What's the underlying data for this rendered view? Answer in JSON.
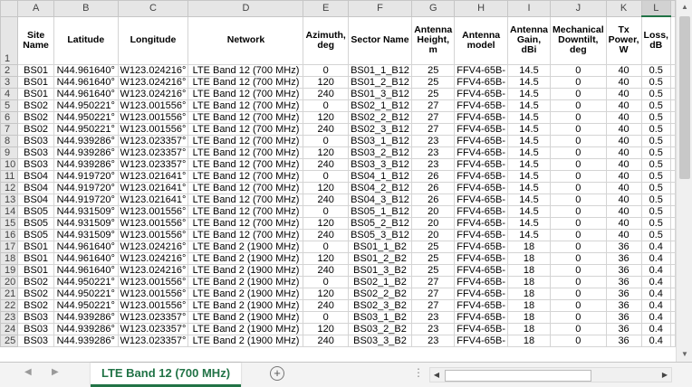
{
  "columns": [
    "A",
    "B",
    "C",
    "D",
    "E",
    "F",
    "G",
    "H",
    "I",
    "J",
    "K",
    "L"
  ],
  "selected_column": "L",
  "headers": [
    "Site Name",
    "Latitude",
    "Longitude",
    "Network",
    "Azimuth, deg",
    "Sector Name",
    "Antenna Height, m",
    "Antenna model",
    "Antenna Gain, dBi",
    "Mechanical Downtilt, deg",
    "Tx Power, W",
    "Loss, dB"
  ],
  "rows": [
    [
      "2",
      "BS01",
      "N44.961640°",
      "W123.024216°",
      "LTE Band 12 (700 MHz)",
      "0",
      "BS01_1_B12",
      "25",
      "FFV4-65B-",
      "14.5",
      "0",
      "40",
      "0.5"
    ],
    [
      "3",
      "BS01",
      "N44.961640°",
      "W123.024216°",
      "LTE Band 12 (700 MHz)",
      "120",
      "BS01_2_B12",
      "25",
      "FFV4-65B-",
      "14.5",
      "0",
      "40",
      "0.5"
    ],
    [
      "4",
      "BS01",
      "N44.961640°",
      "W123.024216°",
      "LTE Band 12 (700 MHz)",
      "240",
      "BS01_3_B12",
      "25",
      "FFV4-65B-",
      "14.5",
      "0",
      "40",
      "0.5"
    ],
    [
      "5",
      "BS02",
      "N44.950221°",
      "W123.001556°",
      "LTE Band 12 (700 MHz)",
      "0",
      "BS02_1_B12",
      "27",
      "FFV4-65B-",
      "14.5",
      "0",
      "40",
      "0.5"
    ],
    [
      "6",
      "BS02",
      "N44.950221°",
      "W123.001556°",
      "LTE Band 12 (700 MHz)",
      "120",
      "BS02_2_B12",
      "27",
      "FFV4-65B-",
      "14.5",
      "0",
      "40",
      "0.5"
    ],
    [
      "7",
      "BS02",
      "N44.950221°",
      "W123.001556°",
      "LTE Band 12 (700 MHz)",
      "240",
      "BS02_3_B12",
      "27",
      "FFV4-65B-",
      "14.5",
      "0",
      "40",
      "0.5"
    ],
    [
      "8",
      "BS03",
      "N44.939286°",
      "W123.023357°",
      "LTE Band 12 (700 MHz)",
      "0",
      "BS03_1_B12",
      "23",
      "FFV4-65B-",
      "14.5",
      "0",
      "40",
      "0.5"
    ],
    [
      "9",
      "BS03",
      "N44.939286°",
      "W123.023357°",
      "LTE Band 12 (700 MHz)",
      "120",
      "BS03_2_B12",
      "23",
      "FFV4-65B-",
      "14.5",
      "0",
      "40",
      "0.5"
    ],
    [
      "10",
      "BS03",
      "N44.939286°",
      "W123.023357°",
      "LTE Band 12 (700 MHz)",
      "240",
      "BS03_3_B12",
      "23",
      "FFV4-65B-",
      "14.5",
      "0",
      "40",
      "0.5"
    ],
    [
      "11",
      "BS04",
      "N44.919720°",
      "W123.021641°",
      "LTE Band 12 (700 MHz)",
      "0",
      "BS04_1_B12",
      "26",
      "FFV4-65B-",
      "14.5",
      "0",
      "40",
      "0.5"
    ],
    [
      "12",
      "BS04",
      "N44.919720°",
      "W123.021641°",
      "LTE Band 12 (700 MHz)",
      "120",
      "BS04_2_B12",
      "26",
      "FFV4-65B-",
      "14.5",
      "0",
      "40",
      "0.5"
    ],
    [
      "13",
      "BS04",
      "N44.919720°",
      "W123.021641°",
      "LTE Band 12 (700 MHz)",
      "240",
      "BS04_3_B12",
      "26",
      "FFV4-65B-",
      "14.5",
      "0",
      "40",
      "0.5"
    ],
    [
      "14",
      "BS05",
      "N44.931509°",
      "W123.001556°",
      "LTE Band 12 (700 MHz)",
      "0",
      "BS05_1_B12",
      "20",
      "FFV4-65B-",
      "14.5",
      "0",
      "40",
      "0.5"
    ],
    [
      "15",
      "BS05",
      "N44.931509°",
      "W123.001556°",
      "LTE Band 12 (700 MHz)",
      "120",
      "BS05_2_B12",
      "20",
      "FFV4-65B-",
      "14.5",
      "0",
      "40",
      "0.5"
    ],
    [
      "16",
      "BS05",
      "N44.931509°",
      "W123.001556°",
      "LTE Band 12 (700 MHz)",
      "240",
      "BS05_3_B12",
      "20",
      "FFV4-65B-",
      "14.5",
      "0",
      "40",
      "0.5"
    ],
    [
      "17",
      "BS01",
      "N44.961640°",
      "W123.024216°",
      "LTE Band 2 (1900 MHz)",
      "0",
      "BS01_1_B2",
      "25",
      "FFV4-65B-",
      "18",
      "0",
      "36",
      "0.4"
    ],
    [
      "18",
      "BS01",
      "N44.961640°",
      "W123.024216°",
      "LTE Band 2 (1900 MHz)",
      "120",
      "BS01_2_B2",
      "25",
      "FFV4-65B-",
      "18",
      "0",
      "36",
      "0.4"
    ],
    [
      "19",
      "BS01",
      "N44.961640°",
      "W123.024216°",
      "LTE Band 2 (1900 MHz)",
      "240",
      "BS01_3_B2",
      "25",
      "FFV4-65B-",
      "18",
      "0",
      "36",
      "0.4"
    ],
    [
      "20",
      "BS02",
      "N44.950221°",
      "W123.001556°",
      "LTE Band 2 (1900 MHz)",
      "0",
      "BS02_1_B2",
      "27",
      "FFV4-65B-",
      "18",
      "0",
      "36",
      "0.4"
    ],
    [
      "21",
      "BS02",
      "N44.950221°",
      "W123.001556°",
      "LTE Band 2 (1900 MHz)",
      "120",
      "BS02_2_B2",
      "27",
      "FFV4-65B-",
      "18",
      "0",
      "36",
      "0.4"
    ],
    [
      "22",
      "BS02",
      "N44.950221°",
      "W123.001556°",
      "LTE Band 2 (1900 MHz)",
      "240",
      "BS02_3_B2",
      "27",
      "FFV4-65B-",
      "18",
      "0",
      "36",
      "0.4"
    ],
    [
      "23",
      "BS03",
      "N44.939286°",
      "W123.023357°",
      "LTE Band 2 (1900 MHz)",
      "0",
      "BS03_1_B2",
      "23",
      "FFV4-65B-",
      "18",
      "0",
      "36",
      "0.4"
    ],
    [
      "24",
      "BS03",
      "N44.939286°",
      "W123.023357°",
      "LTE Band 2 (1900 MHz)",
      "120",
      "BS03_2_B2",
      "23",
      "FFV4-65B-",
      "18",
      "0",
      "36",
      "0.4"
    ],
    [
      "25",
      "BS03",
      "N44.939286°",
      "W123.023357°",
      "LTE Band 2 (1900 MHz)",
      "240",
      "BS03_3_B2",
      "23",
      "FFV4-65B-",
      "18",
      "0",
      "36",
      "0.4"
    ]
  ],
  "sheet_tab": "LTE Band 12 (700 MHz)",
  "colors": {
    "accent": "#217346",
    "header_bg": "#e6e6e6"
  },
  "icons": {
    "add_sheet": "plus-circle-icon",
    "nav_left": "triangle-left-icon",
    "nav_right": "triangle-right-icon"
  }
}
